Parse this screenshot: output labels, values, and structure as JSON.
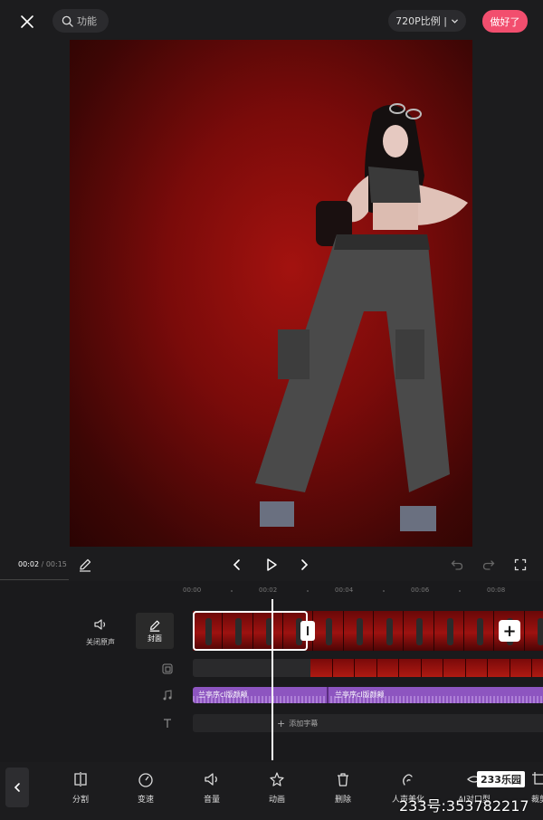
{
  "header": {
    "search_label": "功能",
    "ratio_label": "720P比例 |",
    "done_label": "做好了"
  },
  "playback": {
    "current_time": "00:02",
    "separator": " / ",
    "total_time": "00:15"
  },
  "ruler": {
    "ticks": [
      "00:00",
      "00:02",
      "00:04",
      "00:06",
      "00:08"
    ]
  },
  "tracks": {
    "mute_label": "关闭原声",
    "cover_label": "封面",
    "audio_clips": [
      "兰亭序cl版颜颠",
      "兰亭序cl版颜颠"
    ],
    "add_subtitle_label": "添加字幕"
  },
  "toolbar": {
    "items": [
      {
        "label": "分割",
        "icon": "split-icon"
      },
      {
        "label": "变速",
        "icon": "speed-icon"
      },
      {
        "label": "音量",
        "icon": "volume-icon"
      },
      {
        "label": "动画",
        "icon": "animation-icon"
      },
      {
        "label": "删除",
        "icon": "delete-icon"
      },
      {
        "label": "人声美化",
        "icon": "voice-icon"
      },
      {
        "label": "AI对口型",
        "icon": "ai-icon"
      },
      {
        "label": "裁剪",
        "icon": "crop-icon"
      }
    ]
  },
  "watermark": {
    "logo": "233乐园",
    "text": "233号:353782217"
  },
  "colors": {
    "accent": "#f24e6e",
    "audio": "#8d55c0"
  }
}
